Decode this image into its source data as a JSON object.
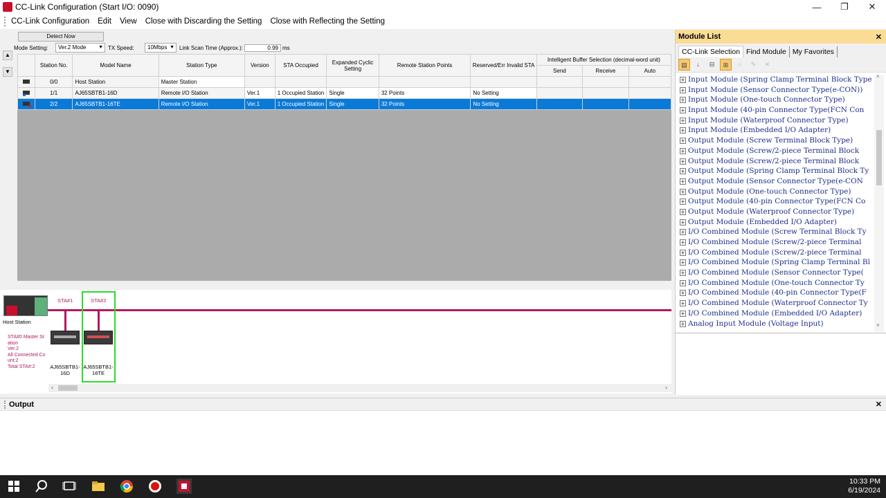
{
  "window": {
    "title": "CC-Link Configuration (Start I/O: 0090)",
    "controls": {
      "minimize": "—",
      "maximize": "❐",
      "close": "✕"
    }
  },
  "menu": {
    "items": [
      "CC-Link Configuration",
      "Edit",
      "View",
      "Close with Discarding the Setting",
      "Close with Reflecting the Setting"
    ]
  },
  "config": {
    "detect_now": "Detect Now",
    "mode_label": "Mode Setting:",
    "mode_value": "Ver.2 Mode",
    "tx_label": "TX Speed:",
    "tx_value": "10Mbps",
    "scan_label": "Link Scan Time (Approx.):",
    "scan_value": "0.99",
    "scan_unit": "ms"
  },
  "table": {
    "headers": {
      "station_no": "Station No.",
      "model_name": "Model Name",
      "station_type": "Station Type",
      "version": "Version",
      "sta_occupied": "STA Occupied",
      "expanded_cyclic": "Expanded Cyclic Setting",
      "remote_points": "Remote Station Points",
      "reserved": "Reserved/Err Invalid STA",
      "buffer_group": "Intelligent Buffer Selection (decimal-word unit)",
      "send": "Send",
      "receive": "Receive",
      "auto": "Auto"
    },
    "rows": [
      {
        "station_no": "0/0",
        "model_name": "Host Station",
        "station_type": "Master Station",
        "version": "",
        "sta_occupied": "",
        "expanded_cyclic": "",
        "remote_points": "",
        "reserved": ""
      },
      {
        "station_no": "1/1",
        "model_name": "AJ65SBTB1-16D",
        "station_type": "Remote I/O Station",
        "version": "Ver.1",
        "sta_occupied": "1 Occupied Station",
        "expanded_cyclic": "Single",
        "remote_points": "32 Points",
        "reserved": "No Setting"
      },
      {
        "station_no": "2/2",
        "model_name": "AJ65SBTB1-16TE",
        "station_type": "Remote I/O Station",
        "version": "Ver.1",
        "sta_occupied": "1 Occupied Station",
        "expanded_cyclic": "Single",
        "remote_points": "32 Points",
        "reserved": "No Setting"
      }
    ]
  },
  "diagram": {
    "host_label": "Host Station",
    "host_info": [
      "STA#0  Master St",
      "ation",
      "Ver.2",
      "All Connected Co",
      "unt:2",
      "Total STA#:2"
    ],
    "sta1_label": "STA#1",
    "sta2_label": "STA#2",
    "sta1_model": [
      "AJ65SBTB1-",
      "16D"
    ],
    "sta2_model": [
      "AJ65SBTB1-",
      "16TE"
    ]
  },
  "module_list": {
    "title": "Module List",
    "tabs": [
      "CC-Link Selection",
      "Find Module",
      "My Favorites"
    ],
    "items": [
      "Input Module (Spring Clamp Terminal Block Type",
      "Input Module (Sensor Connector Type(e-CON))",
      "Input Module (One-touch Connector Type)",
      "Input Module (40-pin Connector Type(FCN Con",
      "Input Module (Waterproof Connector Type)",
      "Input Module (Embedded I/O Adapter)",
      "Output Module (Screw Terminal Block Type)",
      "Output Module (Screw/2-piece Terminal Block",
      "Output Module (Screw/2-piece Terminal Block",
      "Output Module (Spring Clamp Terminal Block Ty",
      "Output Module (Sensor Connector Type(e-CON",
      "Output Module (One-touch Connector Type)",
      "Output Module (40-pin Connector Type(FCN Co",
      "Output Module (Waterproof Connector Type)",
      "Output Module (Embedded I/O Adapter)",
      "I/O Combined Module (Screw Terminal Block Ty",
      "I/O Combined Module (Screw/2-piece Terminal",
      "I/O Combined Module (Screw/2-piece Terminal",
      "I/O Combined Module (Spring Clamp Terminal Bl",
      "I/O Combined Module (Sensor Connector Type(",
      "I/O Combined Module (One-touch Connector Ty",
      "I/O Combined Module (40-pin Connector Type(F",
      "I/O Combined Module (Waterproof Connector Ty",
      "I/O Combined Module (Embedded I/O Adapter)",
      "Analog Input Module (Voltage Input)"
    ]
  },
  "output": {
    "title": "Output"
  },
  "taskbar": {
    "time": "10:33 PM",
    "date": "6/19/2024"
  }
}
